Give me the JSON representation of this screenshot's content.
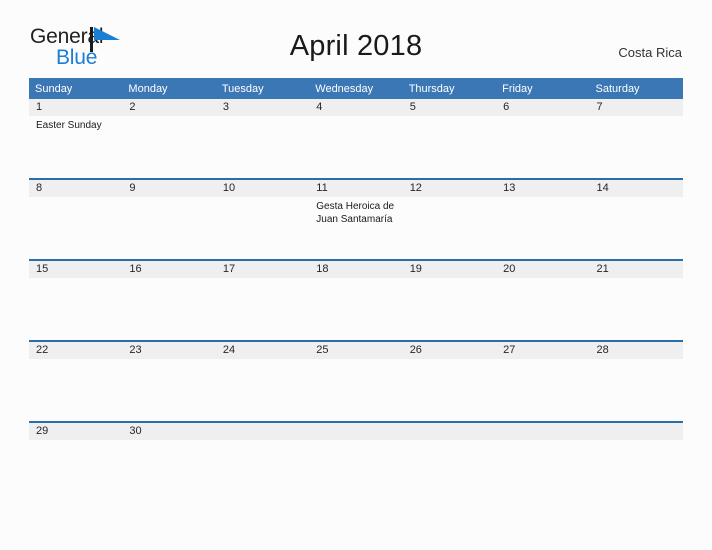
{
  "brand": {
    "name_part1": "General",
    "name_part2": "Blue",
    "flag_icon": "flag-triangle-icon",
    "colors": {
      "general": "#231f20",
      "blue": "#1a7fd4",
      "header_blue": "#3b77b4",
      "row_border_blue": "#2b6da8",
      "date_band": "#efefef"
    }
  },
  "header": {
    "title": "April 2018",
    "region": "Costa Rica"
  },
  "calendar": {
    "weekday_headers": [
      "Sunday",
      "Monday",
      "Tuesday",
      "Wednesday",
      "Thursday",
      "Friday",
      "Saturday"
    ],
    "weeks": [
      {
        "days": [
          {
            "date": "1",
            "events": [
              "Easter Sunday"
            ]
          },
          {
            "date": "2",
            "events": []
          },
          {
            "date": "3",
            "events": []
          },
          {
            "date": "4",
            "events": []
          },
          {
            "date": "5",
            "events": []
          },
          {
            "date": "6",
            "events": []
          },
          {
            "date": "7",
            "events": []
          }
        ]
      },
      {
        "days": [
          {
            "date": "8",
            "events": []
          },
          {
            "date": "9",
            "events": []
          },
          {
            "date": "10",
            "events": []
          },
          {
            "date": "11",
            "events": [
              "Gesta Heroica de Juan Santamaría"
            ]
          },
          {
            "date": "12",
            "events": []
          },
          {
            "date": "13",
            "events": []
          },
          {
            "date": "14",
            "events": []
          }
        ]
      },
      {
        "days": [
          {
            "date": "15",
            "events": []
          },
          {
            "date": "16",
            "events": []
          },
          {
            "date": "17",
            "events": []
          },
          {
            "date": "18",
            "events": []
          },
          {
            "date": "19",
            "events": []
          },
          {
            "date": "20",
            "events": []
          },
          {
            "date": "21",
            "events": []
          }
        ]
      },
      {
        "days": [
          {
            "date": "22",
            "events": []
          },
          {
            "date": "23",
            "events": []
          },
          {
            "date": "24",
            "events": []
          },
          {
            "date": "25",
            "events": []
          },
          {
            "date": "26",
            "events": []
          },
          {
            "date": "27",
            "events": []
          },
          {
            "date": "28",
            "events": []
          }
        ]
      },
      {
        "days": [
          {
            "date": "29",
            "events": []
          },
          {
            "date": "30",
            "events": []
          },
          {
            "date": "",
            "events": []
          },
          {
            "date": "",
            "events": []
          },
          {
            "date": "",
            "events": []
          },
          {
            "date": "",
            "events": []
          },
          {
            "date": "",
            "events": []
          }
        ]
      }
    ]
  }
}
